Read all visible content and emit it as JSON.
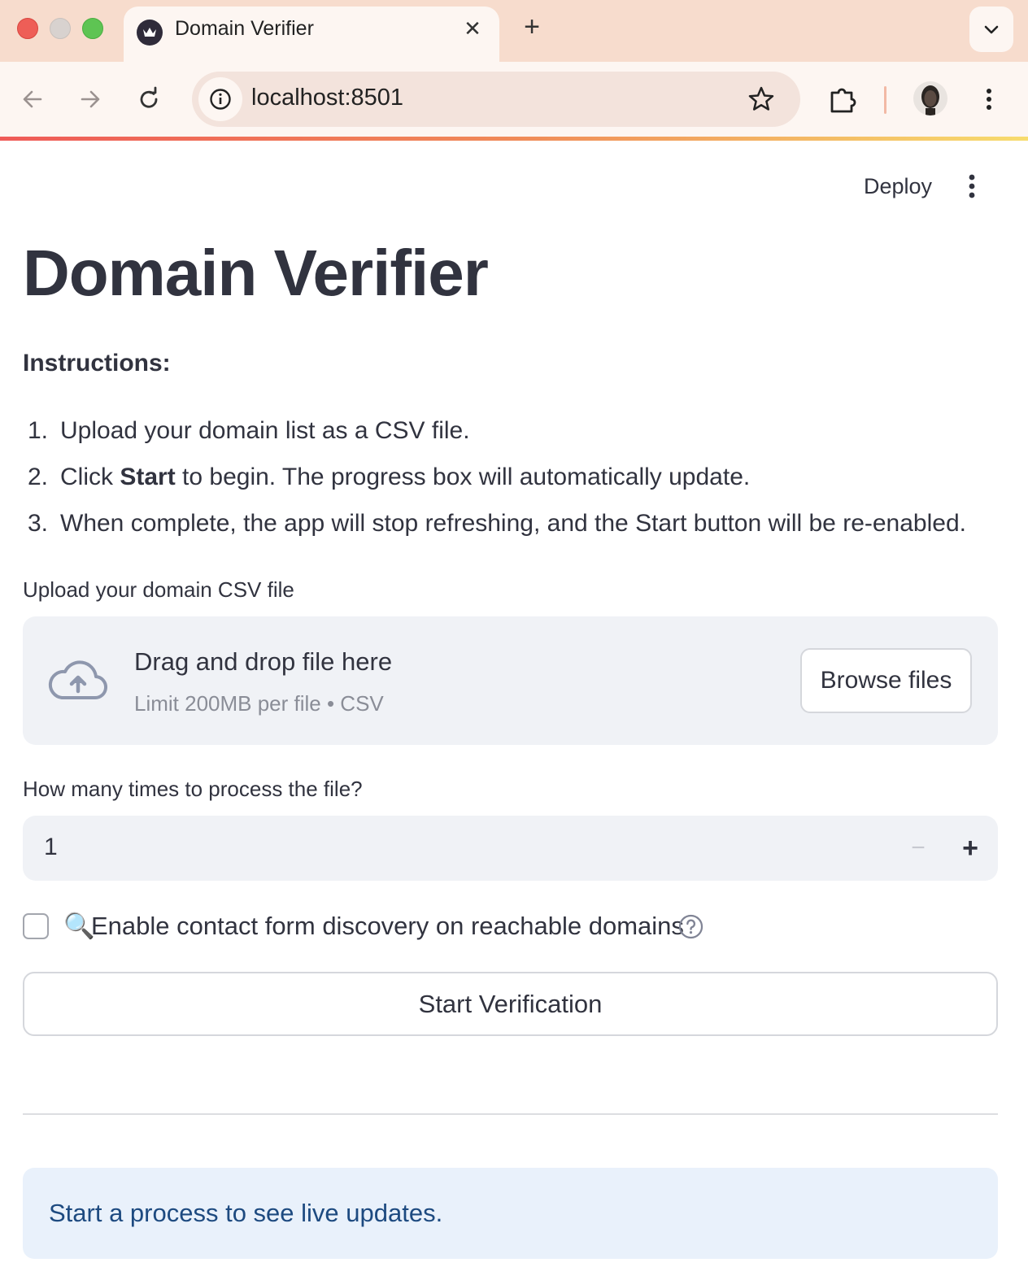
{
  "browser": {
    "tab_title": "Domain Verifier",
    "tab_close": "✕",
    "new_tab": "+",
    "url": "localhost:8501"
  },
  "app": {
    "deploy_label": "Deploy",
    "title": "Domain Verifier",
    "instructions_heading": "Instructions:",
    "instructions": [
      {
        "num": "1.",
        "pre": "Upload your domain list as a CSV file.",
        "bold": "",
        "post": ""
      },
      {
        "num": "2.",
        "pre": "Click ",
        "bold": "Start",
        "post": " to begin. The progress box will automatically update."
      },
      {
        "num": "3.",
        "pre": "When complete, the app will stop refreshing, and the Start button will be re-enabled.",
        "bold": "",
        "post": ""
      }
    ],
    "uploader": {
      "label": "Upload your domain CSV file",
      "drop_title": "Drag and drop file here",
      "drop_subtitle": "Limit 200MB per file • CSV",
      "browse_label": "Browse files"
    },
    "number_input": {
      "label": "How many times to process the file?",
      "value": "1",
      "minus": "−",
      "plus": "+"
    },
    "checkbox": {
      "emoji": "🔍",
      "label": "Enable contact form discovery on reachable domains",
      "checked": false
    },
    "start_button": "Start Verification",
    "info_message": "Start a process to see live updates."
  },
  "colors": {
    "text": "#31333f",
    "widget_bg": "#f0f2f6",
    "info_bg": "#e9f1fb",
    "info_text": "#1d4a80",
    "tabbar_bg": "#f7dccd"
  },
  "icons": [
    "crown-favicon-icon",
    "close-icon",
    "plus-icon",
    "chevron-down-icon",
    "back-arrow-icon",
    "forward-arrow-icon",
    "reload-icon",
    "site-info-icon",
    "star-icon",
    "extensions-icon",
    "profile-avatar",
    "more-vert-icon",
    "cloud-upload-icon",
    "help-icon"
  ]
}
